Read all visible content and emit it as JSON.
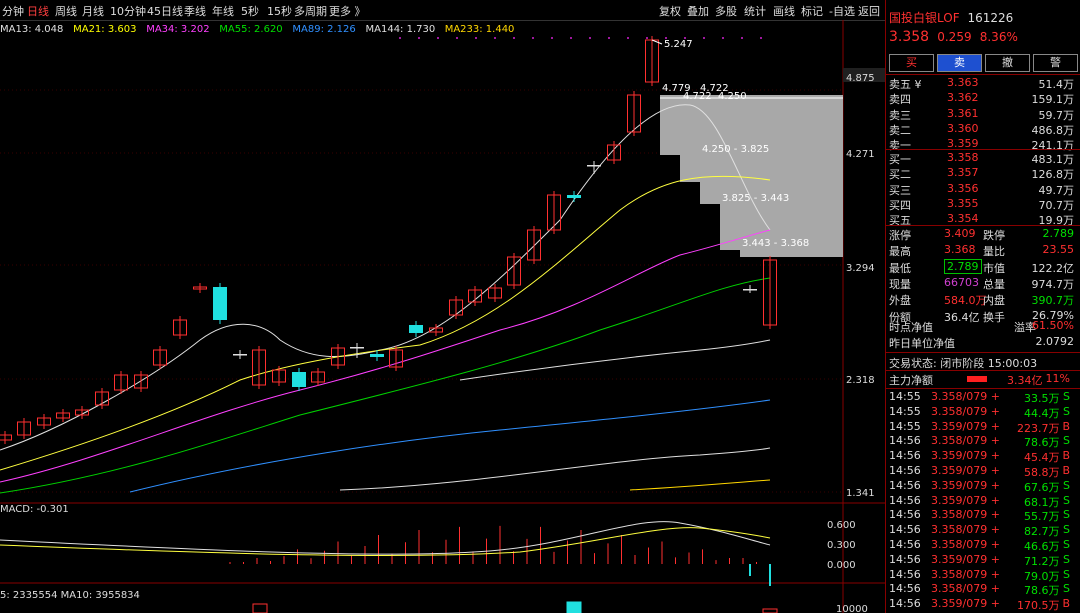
{
  "toolbar": {
    "periods": [
      "分钟",
      "日线",
      "周线",
      "月线",
      "10分钟",
      "45日线",
      "季线",
      "年线",
      "5秒",
      "15秒",
      "多周期",
      "更多 》"
    ],
    "active_index": 1,
    "buttons": [
      "复权",
      "叠加",
      "多股",
      "统计",
      "画线",
      "标记",
      "-自选",
      "返回"
    ]
  },
  "ma_legend": [
    {
      "text": "MA13: 4.048",
      "color": "#e0e0e0"
    },
    {
      "text": "MA21: 3.603",
      "color": "#ffff00"
    },
    {
      "text": "MA34: 3.202",
      "color": "#ff40ff"
    },
    {
      "text": "MA55: 2.620",
      "color": "#00e000"
    },
    {
      "text": "MA89: 2.126",
      "color": "#3090ff"
    },
    {
      "text": "MA144: 1.730",
      "color": "#e0e0e0"
    },
    {
      "text": "MA233: 1.440",
      "color": "#ffd700"
    }
  ],
  "macd_label": "MACD: -0.301",
  "vol_label": "5: 2335554  MA10: 3955834",
  "price_axis": [
    "4.875",
    "4.271",
    "3.294",
    "2.318",
    "1.341"
  ],
  "macd_axis": [
    "0.600",
    "0.300",
    "0.000"
  ],
  "vol_axis": [
    "10000"
  ],
  "annotations": {
    "high": "5.247",
    "a1": "4.779",
    "a2": "4.722",
    "a3": "4.722",
    "a4": "4.250",
    "a5": "4.250 - 3.825",
    "a6": "3.825 - 3.443",
    "a7": "3.443 - 3.368"
  },
  "quote": {
    "name": "国投白银LOF",
    "code": "161226",
    "price": "3.358",
    "change": "0.259",
    "pct": "8.36%",
    "trade_buttons": [
      "买",
      "卖",
      "撤",
      "警"
    ],
    "asks": [
      {
        "label": "卖五 ¥",
        "price": "3.363",
        "vol": "51.4万"
      },
      {
        "label": "卖四",
        "price": "3.362",
        "vol": "159.1万"
      },
      {
        "label": "卖三",
        "price": "3.361",
        "vol": "59.7万"
      },
      {
        "label": "卖二",
        "price": "3.360",
        "vol": "486.8万"
      },
      {
        "label": "卖一",
        "price": "3.359",
        "vol": "241.1万"
      }
    ],
    "bids": [
      {
        "label": "买一",
        "price": "3.358",
        "vol": "483.1万"
      },
      {
        "label": "买二",
        "price": "3.357",
        "vol": "126.8万"
      },
      {
        "label": "买三",
        "price": "3.356",
        "vol": "49.7万"
      },
      {
        "label": "买四",
        "price": "3.355",
        "vol": "70.7万"
      },
      {
        "label": "买五",
        "price": "3.354",
        "vol": "19.9万"
      }
    ],
    "stats": [
      {
        "l1": "涨停",
        "v1": "3.409",
        "c1": "red",
        "l2": "跌停",
        "v2": "2.789",
        "c2": "green"
      },
      {
        "l1": "最高",
        "v1": "3.368",
        "c1": "red",
        "l2": "量比",
        "v2": "23.55",
        "c2": "red"
      },
      {
        "l1": "最低",
        "v1": "2.789",
        "c1": "green",
        "l2": "市值",
        "v2": "122.2亿",
        "c2": "white"
      },
      {
        "l1": "现量",
        "v1": "66703",
        "c1": "magenta",
        "l2": "总量",
        "v2": "974.7万",
        "c2": "white"
      },
      {
        "l1": "外盘",
        "v1": "584.0万",
        "c1": "red",
        "l2": "内盘",
        "v2": "390.7万",
        "c2": "green"
      },
      {
        "l1": "份额",
        "v1": "36.4亿",
        "c1": "white",
        "l2": "换手",
        "v2": "26.79%",
        "c2": "white"
      }
    ],
    "iopv_label": "时点净值",
    "premium_label": "溢率",
    "premium": "61.50%",
    "prev_nav_label": "昨日单位净值",
    "prev_nav": "2.0792",
    "status": "交易状态: 闭市阶段 15:00:03",
    "main_flow_label": "主力净额",
    "main_flow": "3.34亿",
    "main_flow_pct": "11%",
    "ticks": [
      {
        "t": "14:55",
        "p": "3.358/079 +",
        "v": "33.5万",
        "s": "S"
      },
      {
        "t": "14:55",
        "p": "3.358/079 +",
        "v": "44.4万",
        "s": "S"
      },
      {
        "t": "14:55",
        "p": "3.359/079 +",
        "v": "223.7万",
        "s": "B"
      },
      {
        "t": "14:56",
        "p": "3.358/079 +",
        "v": "78.6万",
        "s": "S"
      },
      {
        "t": "14:56",
        "p": "3.359/079 +",
        "v": "45.4万",
        "s": "B"
      },
      {
        "t": "14:56",
        "p": "3.359/079 +",
        "v": "58.8万",
        "s": "B"
      },
      {
        "t": "14:56",
        "p": "3.359/079 +",
        "v": "67.6万",
        "s": "S"
      },
      {
        "t": "14:56",
        "p": "3.359/079 +",
        "v": "68.1万",
        "s": "S"
      },
      {
        "t": "14:56",
        "p": "3.358/079 +",
        "v": "55.7万",
        "s": "S"
      },
      {
        "t": "14:56",
        "p": "3.358/079 +",
        "v": "82.7万",
        "s": "S"
      },
      {
        "t": "14:56",
        "p": "3.358/079 +",
        "v": "46.6万",
        "s": "S"
      },
      {
        "t": "14:56",
        "p": "3.359/079 +",
        "v": "71.2万",
        "s": "S"
      },
      {
        "t": "14:56",
        "p": "3.358/079 +",
        "v": "79.0万",
        "s": "S"
      },
      {
        "t": "14:56",
        "p": "3.358/079 +",
        "v": "78.6万",
        "s": "S"
      },
      {
        "t": "14:56",
        "p": "3.359/079 +",
        "v": "170.5万",
        "s": "B"
      }
    ]
  }
}
